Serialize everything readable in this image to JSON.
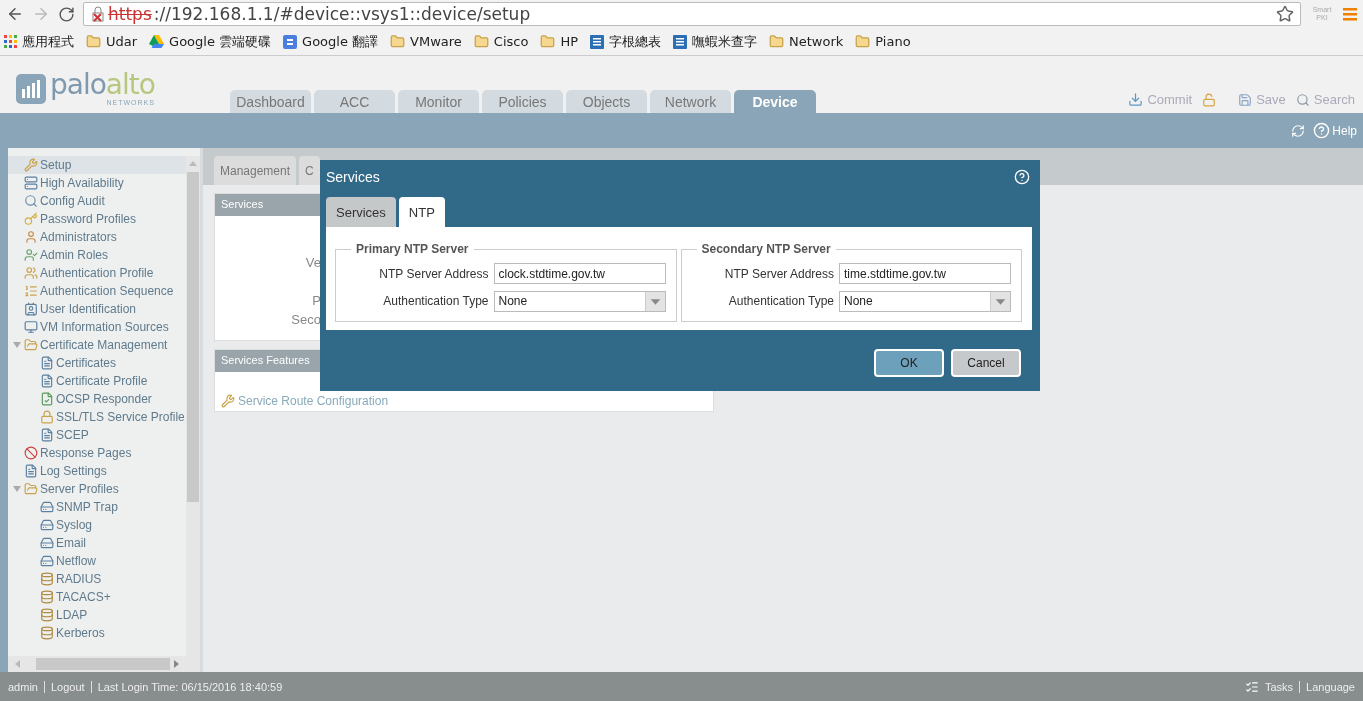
{
  "browser": {
    "url_scheme": "https",
    "url_rest": "://192.168.1.1/#device::vsys1::device/setup",
    "extension": {
      "line_1": "Smart",
      "line_2": "PKI"
    },
    "bookmarks": [
      "應用程式",
      "Udar",
      "Google 雲端硬碟",
      "Google 翻譯",
      "VMware",
      "Cisco",
      "HP",
      "字根總表",
      "嘸蝦米查字",
      "Network",
      "Piano"
    ]
  },
  "logo": {
    "part_1": "palo",
    "part_2": "alto",
    "sub": "NETWORKS"
  },
  "main_tabs": [
    {
      "label": "Dashboard",
      "selected": false
    },
    {
      "label": "ACC",
      "selected": false
    },
    {
      "label": "Monitor",
      "selected": false
    },
    {
      "label": "Policies",
      "selected": false
    },
    {
      "label": "Objects",
      "selected": false
    },
    {
      "label": "Network",
      "selected": false
    },
    {
      "label": "Device",
      "selected": true
    }
  ],
  "header_actions": [
    {
      "kind": "commit",
      "label": "Commit"
    },
    {
      "kind": "save",
      "label": "Save"
    },
    {
      "kind": "search",
      "label": "Search"
    }
  ],
  "help": "Help",
  "sidebar": {
    "items": [
      {
        "label": "Setup",
        "selected": true
      },
      {
        "label": "High Availability",
        "selected": false
      },
      {
        "label": "Config Audit",
        "selected": false
      },
      {
        "label": "Password Profiles",
        "selected": false
      },
      {
        "label": "Administrators",
        "selected": false
      },
      {
        "label": "Admin Roles",
        "selected": false
      },
      {
        "label": "Authentication Profile",
        "selected": false
      },
      {
        "label": "Authentication Sequence",
        "selected": false
      },
      {
        "label": "User Identification",
        "selected": false
      },
      {
        "label": "VM Information Sources",
        "selected": false
      },
      {
        "label": "Certificate Management",
        "selected": false,
        "expanded": true,
        "children": [
          {
            "label": "Certificates",
            "selected": false
          },
          {
            "label": "Certificate Profile",
            "selected": false
          },
          {
            "label": "OCSP Responder",
            "selected": false
          },
          {
            "label": "SSL/TLS Service Profile",
            "selected": false
          },
          {
            "label": "SCEP",
            "selected": false
          }
        ]
      },
      {
        "label": "Response Pages",
        "selected": false
      },
      {
        "label": "Log Settings",
        "selected": false
      },
      {
        "label": "Server Profiles",
        "selected": false,
        "expanded": true,
        "children": [
          {
            "label": "SNMP Trap",
            "selected": false
          },
          {
            "label": "Syslog",
            "selected": false
          },
          {
            "label": "Email",
            "selected": false
          },
          {
            "label": "Netflow",
            "selected": false
          },
          {
            "label": "RADIUS",
            "selected": false
          },
          {
            "label": "TACACS+",
            "selected": false
          },
          {
            "label": "LDAP",
            "selected": false
          },
          {
            "label": "Kerberos",
            "selected": false
          }
        ]
      }
    ]
  },
  "content": {
    "sub_tabs": [
      {
        "label": "Management",
        "selected": false
      },
      {
        "label": "C",
        "selected": false
      }
    ],
    "services_panel": {
      "title": "Services",
      "labels": [
        "Ve",
        "P",
        "Seco"
      ]
    },
    "features_panel": {
      "title": "Services Features",
      "link": "Service Route Configuration"
    }
  },
  "dialog": {
    "title": "Services",
    "tabs": [
      {
        "label": "Services",
        "selected": false
      },
      {
        "label": "NTP",
        "selected": true
      }
    ],
    "groups": [
      {
        "title": "Primary NTP Server",
        "address_label": "NTP Server Address",
        "address": "clock.stdtime.gov.tw",
        "auth_label": "Authentication Type",
        "auth": "None"
      },
      {
        "title": "Secondary NTP Server",
        "address_label": "NTP Server Address",
        "address": "time.stdtime.gov.tw",
        "auth_label": "Authentication Type",
        "auth": "None"
      }
    ],
    "buttons": [
      {
        "kind": "primary",
        "label": "OK"
      },
      {
        "kind": "secondary",
        "label": "Cancel"
      }
    ]
  },
  "footer": {
    "user": "admin",
    "logout": "Logout",
    "last_login": "Last Login Time: 06/15/2016 18:40:59",
    "tasks": "Tasks",
    "language": "Language"
  }
}
